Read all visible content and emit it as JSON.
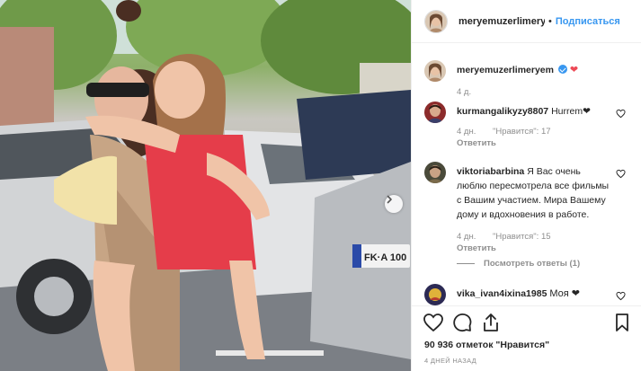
{
  "header": {
    "username": "meryemuzerlimeryem",
    "separator": "•",
    "follow_label": "Подписаться"
  },
  "caption": {
    "username": "meryemuzerlimeryem",
    "heart": "❤",
    "time": "4 д."
  },
  "comments": [
    {
      "username": "kurmangalikyzy8807",
      "text": "Hurrem❤",
      "time": "4 дн.",
      "likes": "\"Нравится\": 17",
      "reply": "Ответить"
    },
    {
      "username": "viktoriabarbina",
      "text": "Я Вас очень люблю пересмотрела все фильмы с Вашим участием. Мира Вашему дому и вдохновения в работе.",
      "time": "4 дн.",
      "likes": "\"Нравится\": 15",
      "reply": "Ответить"
    },
    {
      "username": "vika_ivan4ixina1985",
      "text": "Моя ❤"
    }
  ],
  "view_replies": "Посмотреть ответы (1)",
  "likes_text": "90 936 отметок \"Нравится\"",
  "post_date": "4 ДНЕЙ НАЗАД",
  "colors": {
    "link_blue": "#3897f0",
    "heart_red": "#ed4956",
    "muted_gray": "#8e8e8e"
  }
}
